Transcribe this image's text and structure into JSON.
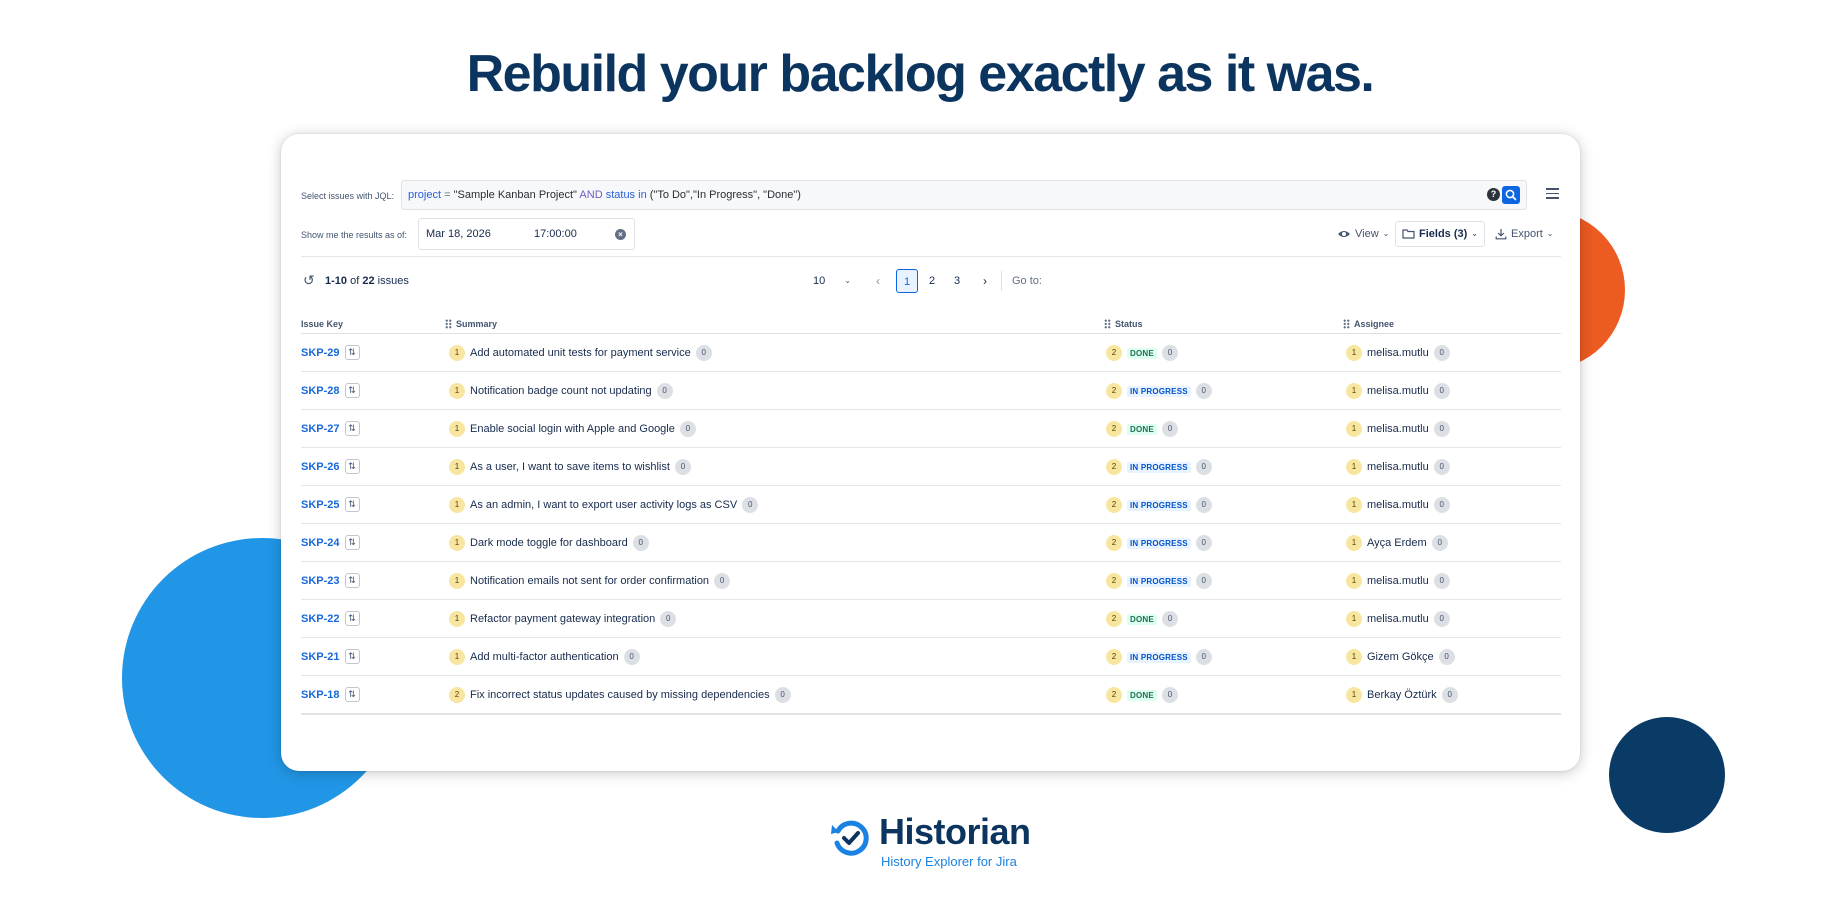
{
  "headline": "Rebuild your backlog exactly as it was.",
  "jql": {
    "label": "Select issues with JQL:",
    "tokens": {
      "k1": "project",
      "o1": " = ",
      "s1": "\"Sample Kanban Project\" ",
      "k2": "AND",
      "k3": " status",
      "o2": " in ",
      "s2": "(\"To Do\",\"In Progress\", \"Done\")"
    },
    "help": "?"
  },
  "as_of": {
    "label": "Show me the results as of:",
    "date": "Mar 18, 2026",
    "time": "17:00:00"
  },
  "toolbar": {
    "view": "View",
    "fields": "Fields (3)",
    "export": "Export"
  },
  "pagination": {
    "range": "1-10",
    "of": " of ",
    "total": "22",
    "suffix": " issues",
    "page_size": "10",
    "pages": [
      "1",
      "2",
      "3"
    ],
    "goto": "Go to:"
  },
  "columns": {
    "key": "Issue Key",
    "summary": "Summary",
    "status": "Status",
    "assignee": "Assignee"
  },
  "rows": [
    {
      "key": "SKP-29",
      "sum_count": "1",
      "summary": "Add automated unit tests for payment service",
      "sum_badge": "0",
      "status_count": "2",
      "status": "DONE",
      "status_type": "done",
      "status_badge": "0",
      "asg_count": "1",
      "assignee": "melisa.mutlu",
      "asg_badge": "0"
    },
    {
      "key": "SKP-28",
      "sum_count": "1",
      "summary": "Notification badge count not updating",
      "sum_badge": "0",
      "status_count": "2",
      "status": "IN PROGRESS",
      "status_type": "progress",
      "status_badge": "0",
      "asg_count": "1",
      "assignee": "melisa.mutlu",
      "asg_badge": "0"
    },
    {
      "key": "SKP-27",
      "sum_count": "1",
      "summary": "Enable social login with Apple and Google",
      "sum_badge": "0",
      "status_count": "2",
      "status": "DONE",
      "status_type": "done",
      "status_badge": "0",
      "asg_count": "1",
      "assignee": "melisa.mutlu",
      "asg_badge": "0"
    },
    {
      "key": "SKP-26",
      "sum_count": "1",
      "summary": "As a user, I want to save items to wishlist",
      "sum_badge": "0",
      "status_count": "2",
      "status": "IN PROGRESS",
      "status_type": "progress",
      "status_badge": "0",
      "asg_count": "1",
      "assignee": "melisa.mutlu",
      "asg_badge": "0"
    },
    {
      "key": "SKP-25",
      "sum_count": "1",
      "summary": "As an admin, I want to export user activity logs as CSV",
      "sum_badge": "0",
      "status_count": "2",
      "status": "IN PROGRESS",
      "status_type": "progress",
      "status_badge": "0",
      "asg_count": "1",
      "assignee": "melisa.mutlu",
      "asg_badge": "0"
    },
    {
      "key": "SKP-24",
      "sum_count": "1",
      "summary": "Dark mode toggle for dashboard",
      "sum_badge": "0",
      "status_count": "2",
      "status": "IN PROGRESS",
      "status_type": "progress",
      "status_badge": "0",
      "asg_count": "1",
      "assignee": "Ayça Erdem",
      "asg_badge": "0"
    },
    {
      "key": "SKP-23",
      "sum_count": "1",
      "summary": "Notification emails not sent for order confirmation",
      "sum_badge": "0",
      "status_count": "2",
      "status": "IN PROGRESS",
      "status_type": "progress",
      "status_badge": "0",
      "asg_count": "1",
      "assignee": "melisa.mutlu",
      "asg_badge": "0"
    },
    {
      "key": "SKP-22",
      "sum_count": "1",
      "summary": "Refactor payment gateway integration",
      "sum_badge": "0",
      "status_count": "2",
      "status": "DONE",
      "status_type": "done",
      "status_badge": "0",
      "asg_count": "1",
      "assignee": "melisa.mutlu",
      "asg_badge": "0"
    },
    {
      "key": "SKP-21",
      "sum_count": "1",
      "summary": "Add multi-factor authentication",
      "sum_badge": "0",
      "status_count": "2",
      "status": "IN PROGRESS",
      "status_type": "progress",
      "status_badge": "0",
      "asg_count": "1",
      "assignee": "Gizem Gökçe",
      "asg_badge": "0"
    },
    {
      "key": "SKP-18",
      "sum_count": "2",
      "summary": "Fix incorrect status updates caused by missing dependencies",
      "sum_badge": "0",
      "status_count": "2",
      "status": "DONE",
      "status_type": "done",
      "status_badge": "0",
      "asg_count": "1",
      "assignee": "Berkay Öztürk",
      "asg_badge": "0"
    }
  ],
  "logo": {
    "title": "Historian",
    "subtitle": "History Explorer for Jira"
  },
  "colors": {
    "headline": "#0b355f",
    "accent_orange": "#ec5b21",
    "accent_blue": "#2196e6",
    "accent_navy": "#0a3a66",
    "link": "#1868db"
  }
}
